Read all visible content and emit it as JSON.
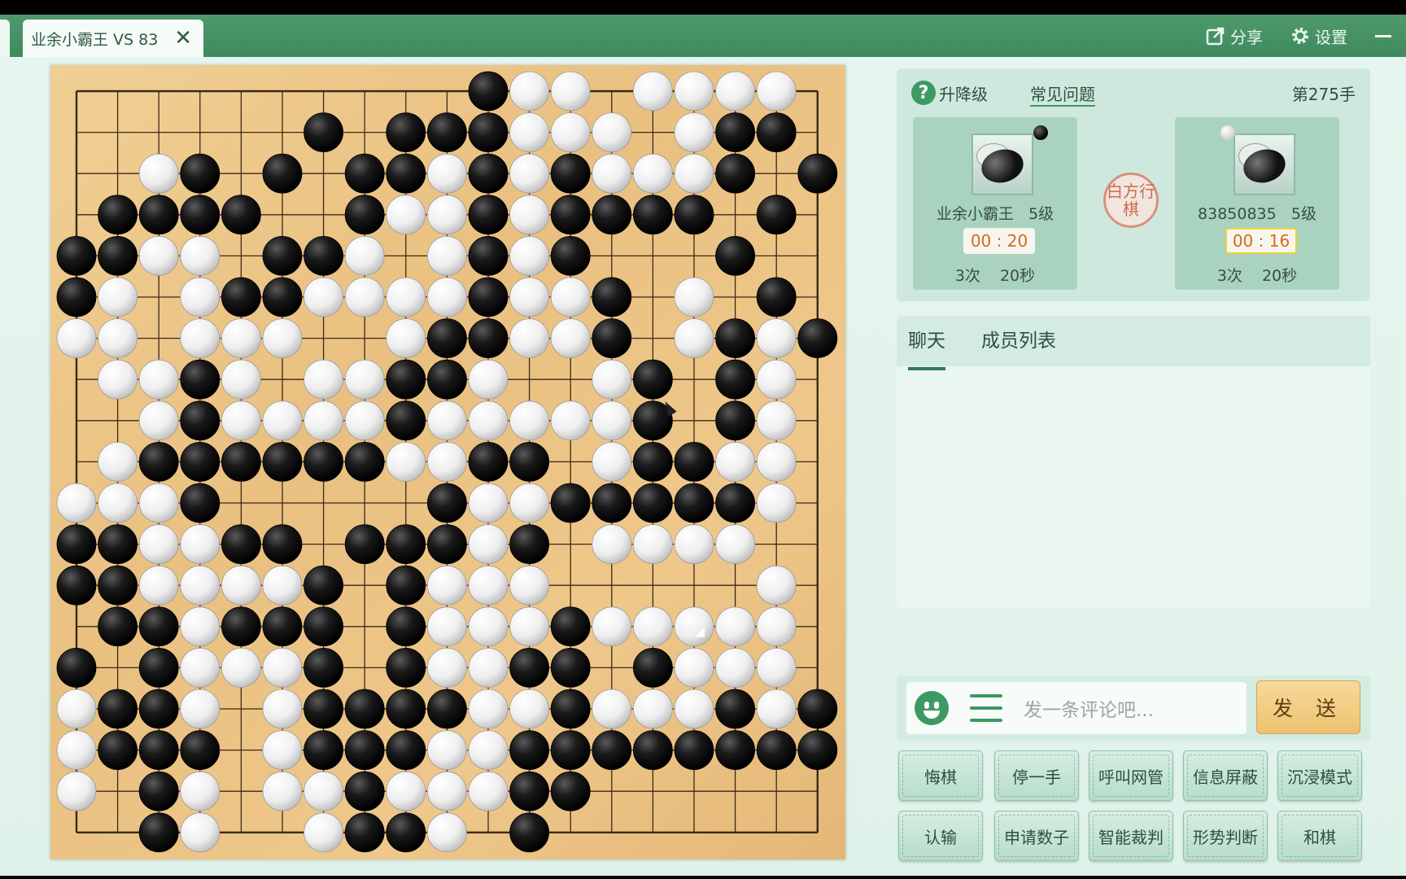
{
  "titlebar": {
    "tab_title": "业余小霸王 VS 83",
    "close": "✕",
    "share_label": "分享",
    "settings_label": "设置"
  },
  "info": {
    "rank_label": "升降级",
    "faq_label": "常见问题",
    "move_count": "第275手",
    "seal_text": "白方行棋",
    "black_player": {
      "name": "业余小霸王",
      "rank": "5级",
      "time": "00 : 20",
      "byoyomi_count": "3次",
      "byoyomi_time": "20秒"
    },
    "white_player": {
      "name": "83850835",
      "rank": "5级",
      "time": "00 : 16",
      "byoyomi_count": "3次",
      "byoyomi_time": "20秒"
    }
  },
  "chat": {
    "tabs": [
      "聊天",
      "成员列表"
    ],
    "placeholder": "发一条评论吧...",
    "send_label": "发 送"
  },
  "actions": [
    "悔棋",
    "停一手",
    "呼叫网管",
    "信息屏蔽",
    "沉浸模式",
    "认输",
    "申请数子",
    "智能裁判",
    "形势判断",
    "和棋"
  ],
  "colors": {
    "accent": "#3d9a63",
    "board": "#ecc587",
    "timer": "#d36a1e"
  },
  "board": {
    "size": 19,
    "last_move": "Q6",
    "rows": [
      "..........BWW.WWWW.",
      "......B.BBBWWW.WBB.",
      "..WB.B.BBWBWBWWWB.B",
      ".BBBB..BWWBWBBBB.B.",
      "BBWW.BBW.WBWB...B..",
      "BW.WBBWWWWBWWB.W.B.",
      "WW.WWW..WBBWWB.WBWB",
      ".WWBW.WWBBW..WB.BW.",
      "..WBWWWWBWWWWWB.BW.",
      ".WBBBBBBWWBB.WBBWW.",
      "WWWB.....BWWBBBBBW.",
      "BBWWBB.BBBWB.WWWW..",
      "BBWWWWB.BWWW.....W.",
      ".BBWBBB.BWWWBWWWWW.",
      "B.BWWWB.BWWBB.BWWW.",
      "WBBW.WBBBBWWBWWWBWB",
      "WBBB.WBBBWWBBBBBBBB",
      "W.BW.WWBWWWBB......",
      "..BW..WBBW.B......."
    ]
  }
}
